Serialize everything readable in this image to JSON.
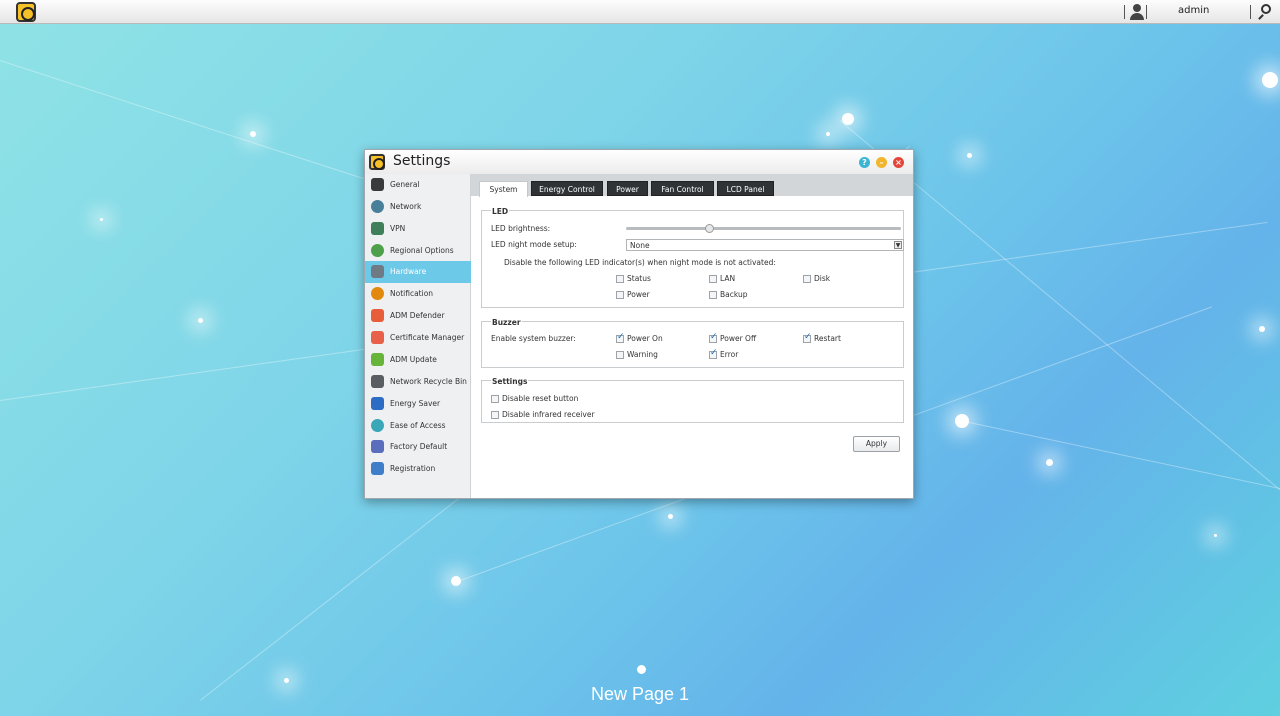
{
  "topbar": {
    "user": "admin"
  },
  "window": {
    "title": "Settings",
    "sidebar": [
      {
        "label": "General",
        "icon": "general-icon"
      },
      {
        "label": "Network",
        "icon": "network-icon"
      },
      {
        "label": "VPN",
        "icon": "vpn-icon"
      },
      {
        "label": "Regional Options",
        "icon": "globe-icon"
      },
      {
        "label": "Hardware",
        "icon": "hardware-icon",
        "active": true
      },
      {
        "label": "Notification",
        "icon": "notification-icon"
      },
      {
        "label": "ADM Defender",
        "icon": "defender-icon"
      },
      {
        "label": "Certificate Manager",
        "icon": "certificate-icon"
      },
      {
        "label": "ADM Update",
        "icon": "update-arrow-icon"
      },
      {
        "label": "Network Recycle Bin",
        "icon": "recycle-bin-icon"
      },
      {
        "label": "Energy Saver",
        "icon": "energy-icon"
      },
      {
        "label": "Ease of Access",
        "icon": "cloud-access-icon"
      },
      {
        "label": "Factory Default",
        "icon": "undo-icon"
      },
      {
        "label": "Registration",
        "icon": "registration-icon"
      }
    ],
    "tabs": [
      "System",
      "Energy Control",
      "Power",
      "Fan Control",
      "LCD Panel"
    ],
    "active_tab": "System",
    "led": {
      "title": "LED",
      "brightness_label": "LED brightness:",
      "brightness_level": 0.3,
      "night_mode_label": "LED night mode setup:",
      "night_mode_value": "None",
      "disable_label": "Disable the following LED indicator(s) when night mode is not activated:",
      "indicators": [
        {
          "label": "Status",
          "checked": false
        },
        {
          "label": "LAN",
          "checked": false
        },
        {
          "label": "Disk",
          "checked": false
        },
        {
          "label": "Power",
          "checked": false
        },
        {
          "label": "Backup",
          "checked": false
        }
      ]
    },
    "buzzer": {
      "title": "Buzzer",
      "label": "Enable system buzzer:",
      "options": [
        {
          "label": "Power On",
          "checked": true
        },
        {
          "label": "Power Off",
          "checked": true
        },
        {
          "label": "Restart",
          "checked": true
        },
        {
          "label": "Warning",
          "checked": false
        },
        {
          "label": "Error",
          "checked": true
        }
      ]
    },
    "settings": {
      "title": "Settings",
      "options": [
        {
          "label": "Disable reset button",
          "checked": false
        },
        {
          "label": "Disable infrared receiver",
          "checked": false
        }
      ]
    },
    "apply_label": "Apply"
  },
  "desktop": {
    "page_label": "New Page 1"
  },
  "colors": {
    "active_sidebar": "#6dc9e8",
    "accent_check": "#1f6fb5"
  }
}
